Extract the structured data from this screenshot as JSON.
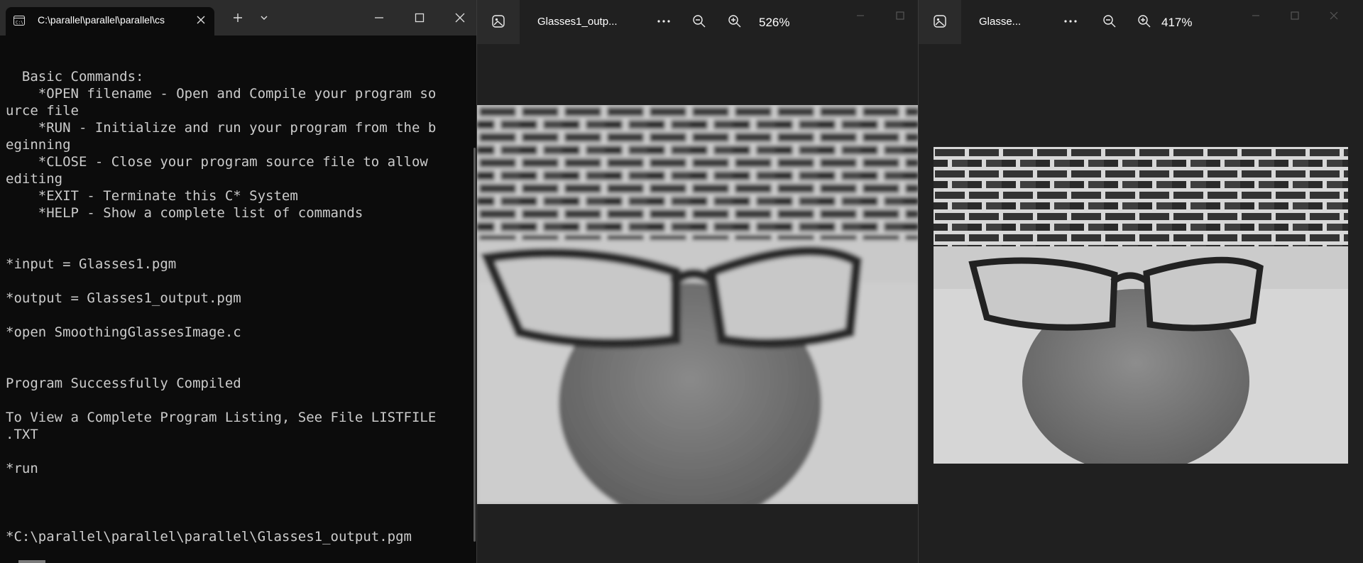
{
  "terminal": {
    "tab_title": "C:\\parallel\\parallel\\parallel\\cs",
    "lines": [
      "  Basic Commands:",
      "    *OPEN filename - Open and Compile your program so",
      "urce file",
      "    *RUN - Initialize and run your program from the b",
      "eginning",
      "    *CLOSE - Close your program source file to allow",
      "editing",
      "    *EXIT - Terminate this C* System",
      "    *HELP - Show a complete list of commands",
      "",
      "",
      "*input = Glasses1.pgm",
      "",
      "*output = Glasses1_output.pgm",
      "",
      "*open SmoothingGlassesImage.c",
      "",
      "",
      "Program Successfully Compiled",
      "",
      "To View a Complete Program Listing, See File LISTFILE",
      ".TXT",
      "",
      "*run",
      "",
      "",
      "",
      "*C:\\parallel\\parallel\\parallel\\Glasses1_output.pgm"
    ],
    "icons": {
      "tab": "terminal-icon",
      "close": "close-icon",
      "new_tab": "plus-icon",
      "dropdown": "chevron-down-icon",
      "minimize": "minimize-icon",
      "maximize": "maximize-icon",
      "window_close": "close-icon"
    }
  },
  "viewer1": {
    "title": "Glasses1_outp...",
    "zoom": "526%",
    "image_style": "blurred grayscale photo of eyeglasses on a glass vase in front of a brick wall"
  },
  "viewer2": {
    "title": "Glasse...",
    "zoom": "417%",
    "image_style": "sharp grayscale photo of eyeglasses on a glass vase in front of a brick wall"
  },
  "colors": {
    "terminal_bg": "#0c0c0c",
    "terminal_text": "#cccccc",
    "titlebar": "#2c2c2c",
    "viewer_bg": "#202020"
  }
}
